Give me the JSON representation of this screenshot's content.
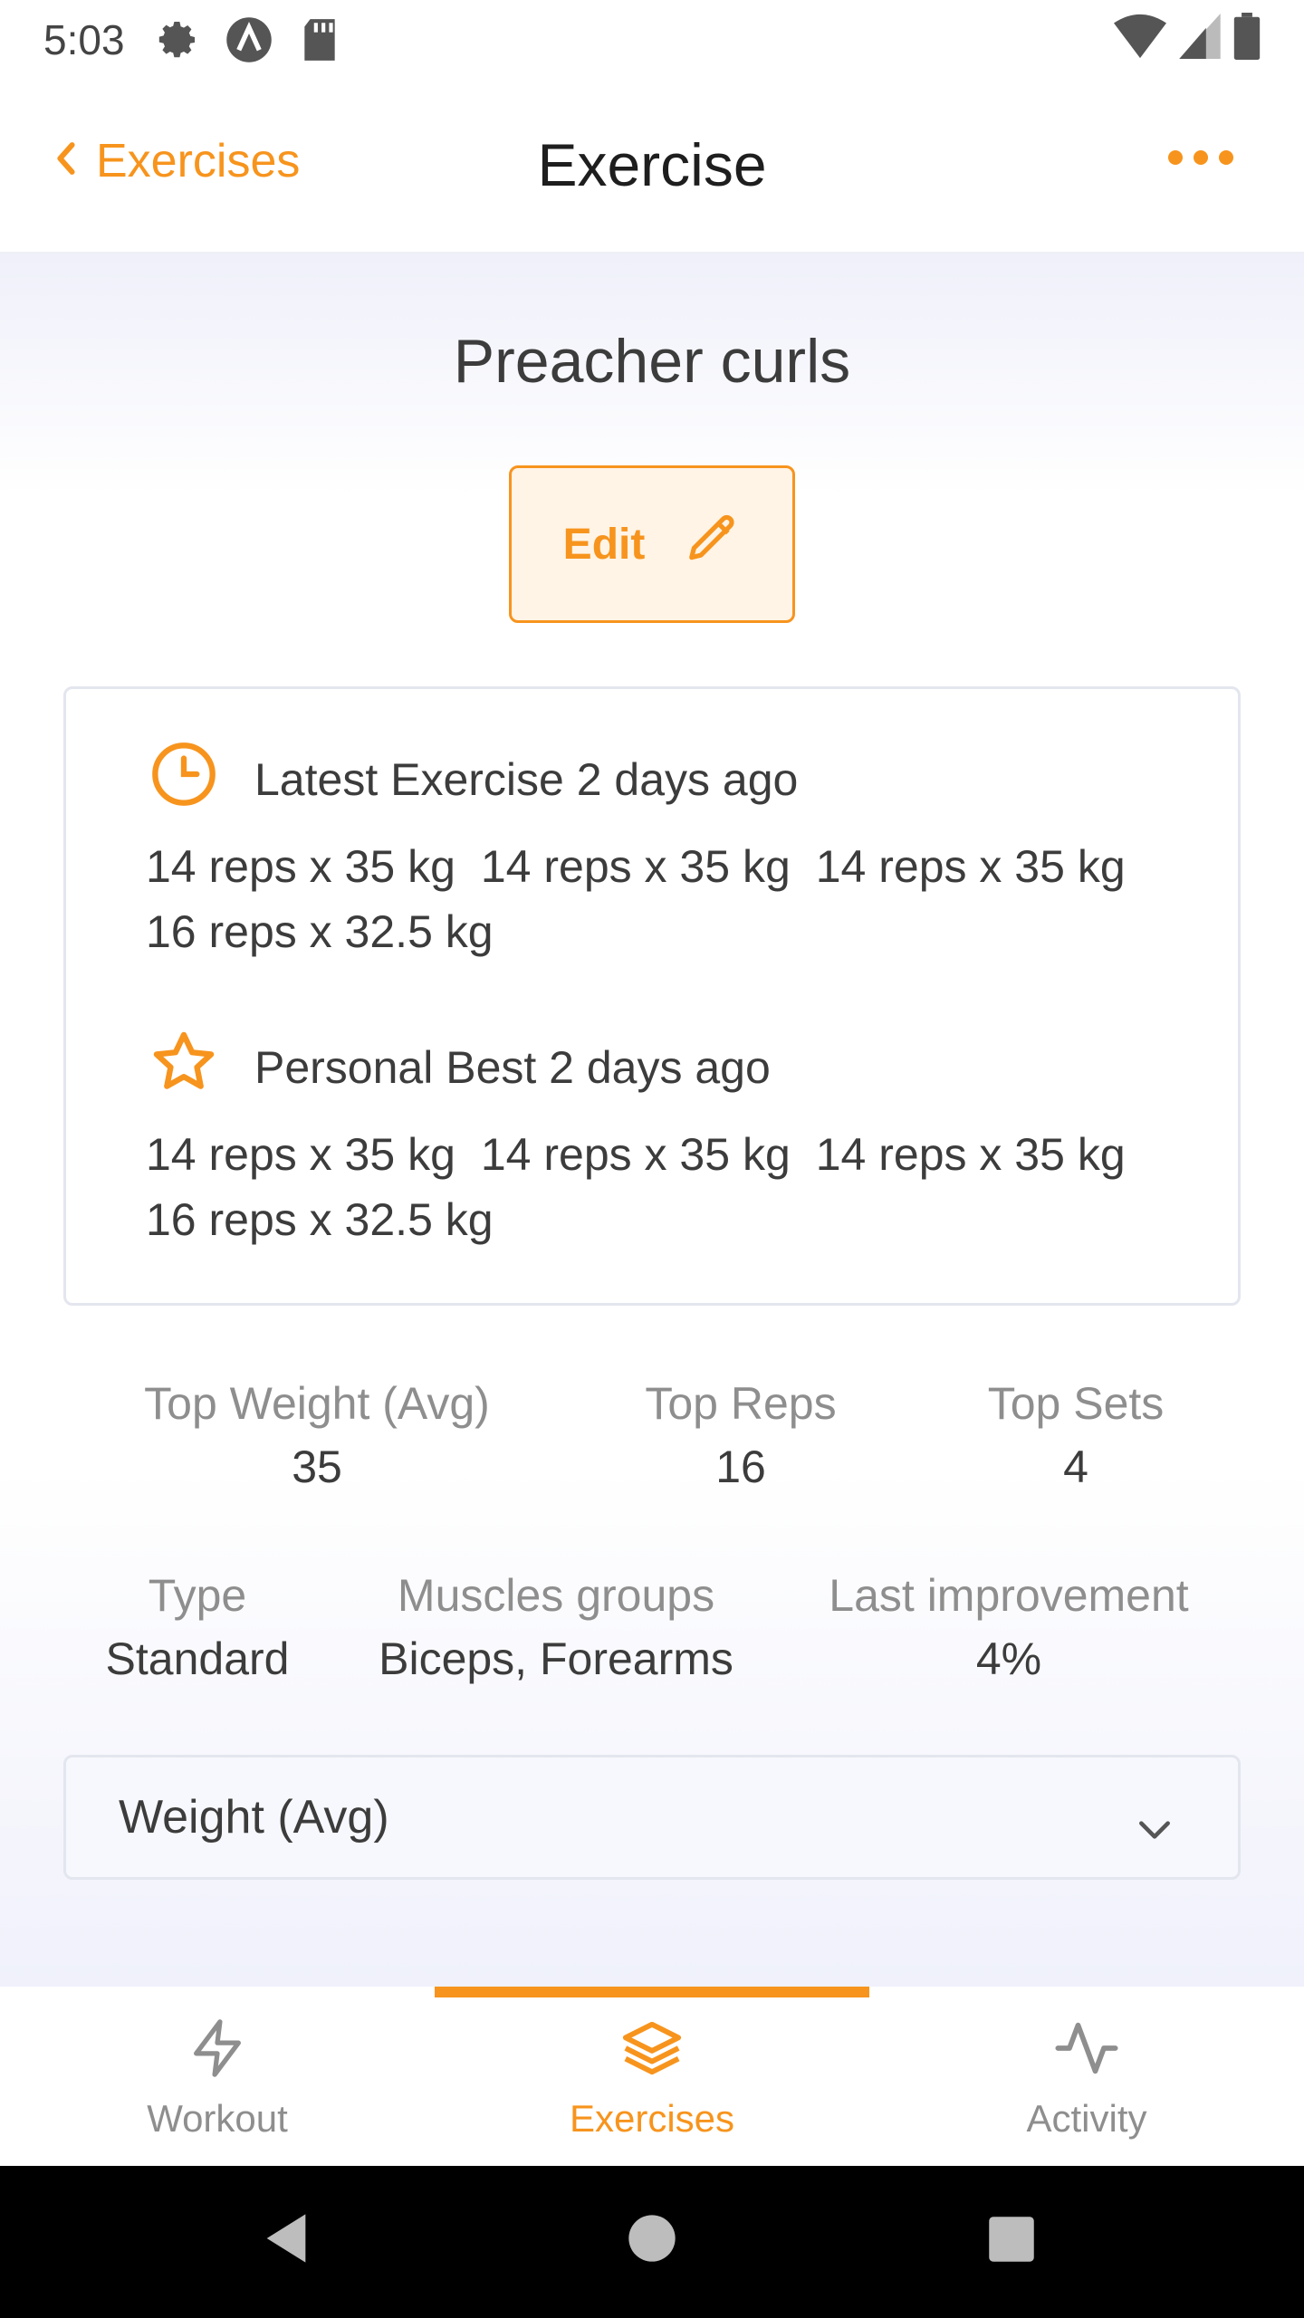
{
  "status_bar": {
    "time": "5:03",
    "icons": [
      "settings-icon",
      "a-logo-icon",
      "sd-card-icon",
      "wifi-icon",
      "signal-icon",
      "battery-icon"
    ]
  },
  "header": {
    "back_label": "Exercises",
    "title": "Exercise",
    "more_icon": "more-horizontal-icon"
  },
  "exercise": {
    "name": "Preacher curls",
    "edit_label": "Edit"
  },
  "latest": {
    "heading": "Latest Exercise 2 days ago",
    "sets": [
      "14 reps x 35 kg",
      "14 reps x 35 kg",
      "14 reps x 35 kg",
      "16 reps x 32.5 kg"
    ]
  },
  "personal_best": {
    "heading": "Personal Best 2 days ago",
    "sets": [
      "14 reps x 35 kg",
      "14 reps x 35 kg",
      "14 reps x 35 kg",
      "16 reps x 32.5 kg"
    ]
  },
  "top_stats": [
    {
      "label": "Top Weight (Avg)",
      "value": "35"
    },
    {
      "label": "Top Reps",
      "value": "16"
    },
    {
      "label": "Top Sets",
      "value": "4"
    }
  ],
  "details": [
    {
      "label": "Type",
      "value": "Standard"
    },
    {
      "label": "Muscles groups",
      "value": "Biceps, Forearms"
    },
    {
      "label": "Last improvement",
      "value": "4%"
    }
  ],
  "chart_selector": {
    "selected": "Weight (Avg)"
  },
  "tabs": [
    {
      "label": "Workout",
      "icon": "lightning-icon",
      "active": false
    },
    {
      "label": "Exercises",
      "icon": "layers-icon",
      "active": true
    },
    {
      "label": "Activity",
      "icon": "activity-icon",
      "active": false
    }
  ],
  "colors": {
    "accent": "#f7941d",
    "text": "#3c3c3c",
    "muted": "#8e8e8e"
  }
}
